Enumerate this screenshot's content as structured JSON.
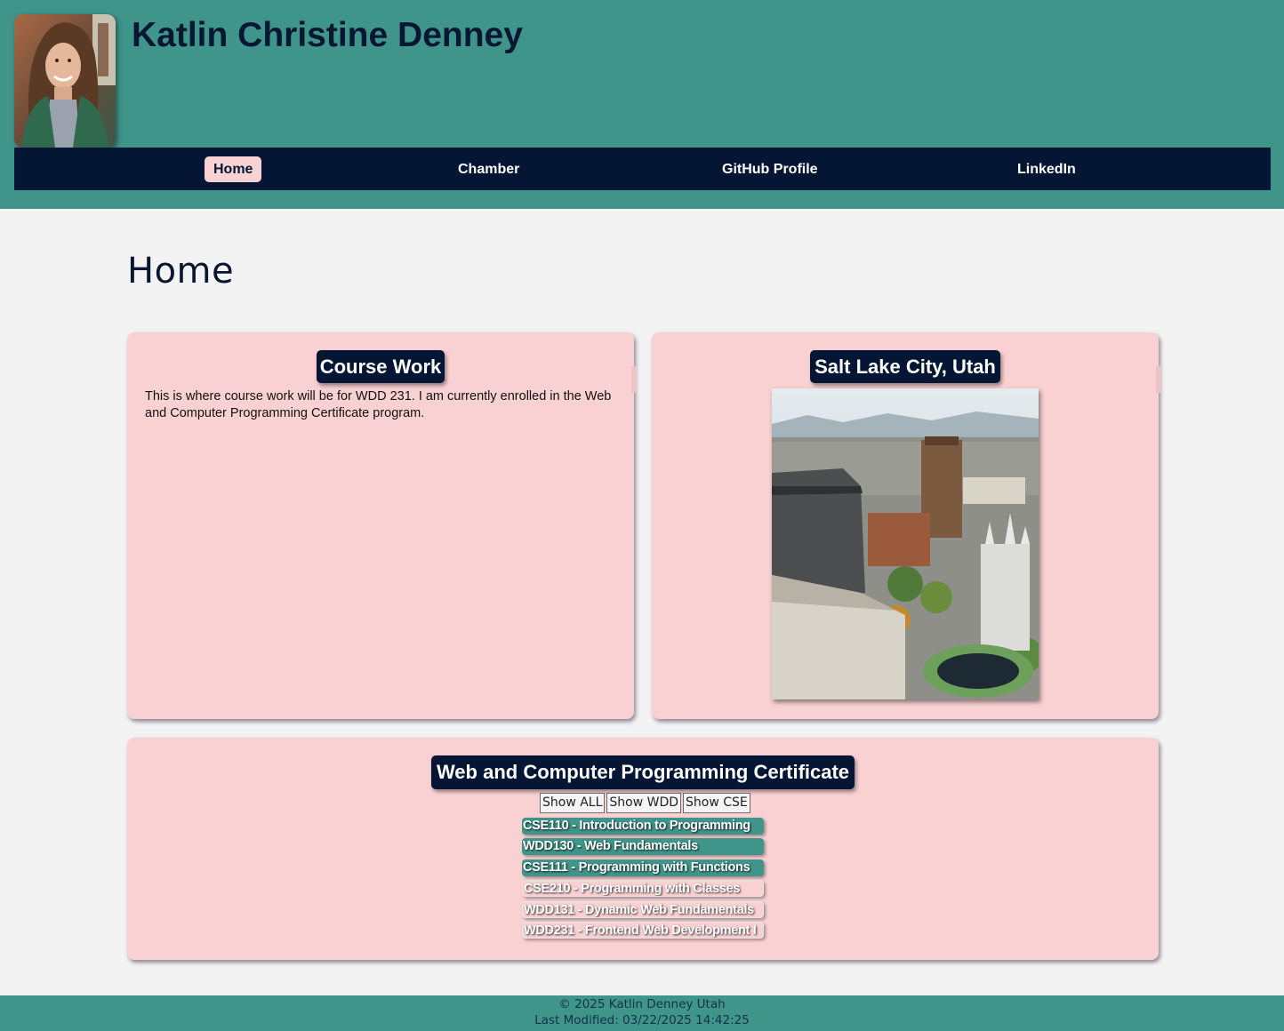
{
  "header": {
    "site_title": "Katlin Christine Denney",
    "avatar_alt": "Profile photo"
  },
  "nav": {
    "items": [
      {
        "label": "Home",
        "active": true
      },
      {
        "label": "Chamber",
        "active": false
      },
      {
        "label": "GitHub Profile",
        "active": false
      },
      {
        "label": "LinkedIn",
        "active": false
      }
    ]
  },
  "main": {
    "heading": "Home",
    "course_work": {
      "title": "Course Work",
      "text": "This is where course work will be for WDD 231. I am currently enrolled in the Web and Computer Programming Certificate program."
    },
    "location": {
      "title": "Salt Lake City, Utah",
      "image_label": "Aerial view of Salt Lake City"
    },
    "certificate": {
      "title": "Web and Computer Programming Certificate",
      "filters": [
        "Show ALL",
        "Show WDD",
        "Show CSE"
      ],
      "courses": [
        {
          "label": "CSE110 - Introduction to Programming",
          "completed": true
        },
        {
          "label": "WDD130 - Web Fundamentals",
          "completed": true
        },
        {
          "label": "CSE111 - Programming with Functions",
          "completed": true
        },
        {
          "label": "CSE210 - Programming with Classes",
          "completed": false
        },
        {
          "label": "WDD131 - Dynamic Web Fundamentals",
          "completed": false
        },
        {
          "label": "WDD231 - Frontend Web Development I",
          "completed": false
        }
      ]
    }
  },
  "footer": {
    "copyright": "© 2025 Katlin Denney Utah",
    "last_modified": "Last Modified: 03/22/2025 14:42:25"
  },
  "colors": {
    "teal": "#40958a",
    "navy": "#041633",
    "pink": "#f9d1d3",
    "background": "#f3f3f3"
  }
}
